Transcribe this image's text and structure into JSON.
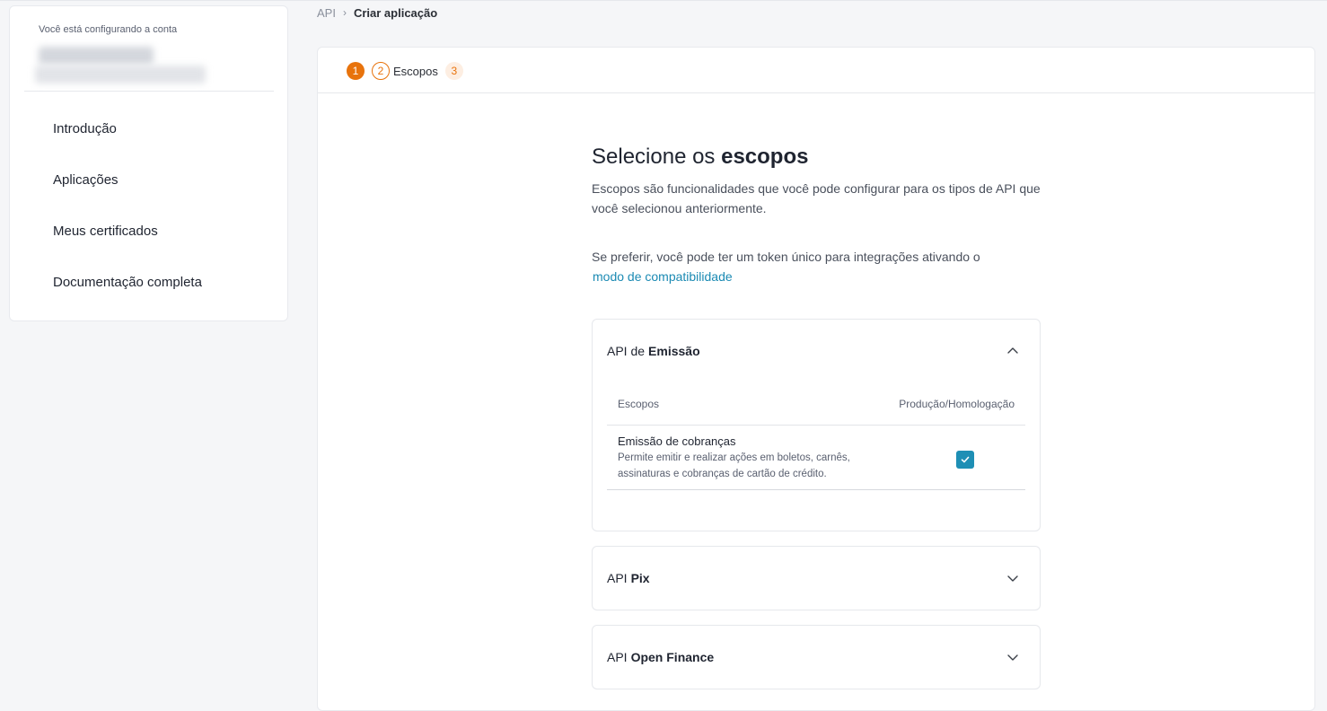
{
  "sidebar": {
    "account_label": "Você está configurando a conta",
    "items": [
      {
        "label": "Introdução"
      },
      {
        "label": "Aplicações"
      },
      {
        "label": "Meus certificados"
      },
      {
        "label": "Documentação completa"
      }
    ]
  },
  "breadcrumb": {
    "root": "API",
    "current": "Criar aplicação"
  },
  "stepper": {
    "step1": "1",
    "step2": "2",
    "step2_label": "Escopos",
    "step3": "3"
  },
  "content": {
    "title_prefix": "Selecione os ",
    "title_bold": "escopos",
    "description": "Escopos são funcionalidades que você pode configurar para os tipos de API que você selecionou anteriormente.",
    "compat_text": "Se preferir, você pode ter um token único para integrações ativando o",
    "compat_link": "modo de compatibilidade"
  },
  "apis": {
    "emissao": {
      "prefix": "API de",
      "name": "Emissão",
      "col_scopes": "Escopos",
      "col_env": "Produção/Homologação",
      "row_title": "Emissão de cobranças",
      "row_desc": "Permite emitir e realizar ações em boletos, carnês, assinaturas e cobranças de cartão de crédito.",
      "checked": true
    },
    "pix": {
      "prefix": "API",
      "name": "Pix"
    },
    "open_finance": {
      "prefix": "API",
      "name": "Open Finance"
    }
  },
  "colors": {
    "accent_orange": "#e8730c",
    "link_blue": "#1b8ab3",
    "checkbox_blue": "#1e8fb5"
  }
}
